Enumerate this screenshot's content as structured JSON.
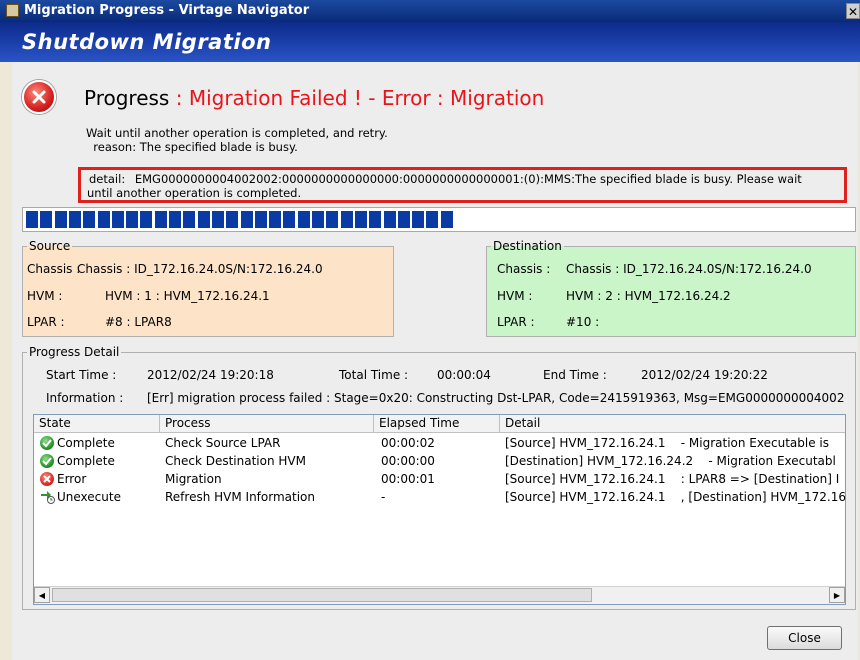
{
  "window": {
    "title": "Migration Progress - Virtage Navigator",
    "close_glyph": "✕"
  },
  "banner": {
    "title": "Shutdown Migration"
  },
  "status": {
    "label": "Progress",
    "separator": ":",
    "message": "Migration Failed ! - Error : Migration",
    "wait_line": "Wait until another operation is completed, and retry.",
    "reason_line": "  reason: The specified blade is busy.",
    "detail_label": "detail:",
    "detail_line1": "EMG0000000004002002:0000000000000000:0000000000000001:(0):MMS:The specified blade is busy. Please wait",
    "detail_line2": "until another operation is completed.",
    "progress_fraction": 0.52,
    "progress_segments": 30
  },
  "source": {
    "legend": "Source",
    "chassis_label": "Chassis :",
    "chassis_value": "Chassis : ID_172.16.24.0S/N:172.16.24.0",
    "hvm_label": "HVM :",
    "hvm_value": "HVM : 1 : HVM_172.16.24.1",
    "lpar_label": "LPAR :",
    "lpar_value": "#8 : LPAR8"
  },
  "destination": {
    "legend": "Destination",
    "chassis_label": "Chassis :",
    "chassis_value": "Chassis : ID_172.16.24.0S/N:172.16.24.0",
    "hvm_label": "HVM :",
    "hvm_value": "HVM : 2 : HVM_172.16.24.2",
    "lpar_label": "LPAR :",
    "lpar_value": "#10 :"
  },
  "progress_detail": {
    "legend": "Progress Detail",
    "start_label": "Start Time :",
    "start_value": "2012/02/24 19:20:18",
    "total_label": "Total Time :",
    "total_value": "00:00:04",
    "end_label": "End Time :",
    "end_value": "2012/02/24 19:20:22",
    "info_label": "Information :",
    "info_value": "[Err] migration process failed : Stage=0x20: Constructing Dst-LPAR, Code=2415919363, Msg=EMG0000000004002",
    "columns": [
      "State",
      "Process",
      "Elapsed Time",
      "Detail"
    ],
    "rows": [
      {
        "icon": "check-icon",
        "state": "Complete",
        "process": "Check Source LPAR",
        "elapsed": "00:00:02",
        "detail": "[Source] HVM_172.16.24.1    - Migration Executable is"
      },
      {
        "icon": "check-icon",
        "state": "Complete",
        "process": "Check Destination HVM",
        "elapsed": "00:00:00",
        "detail": "[Destination] HVM_172.16.24.2    - Migration Executabl"
      },
      {
        "icon": "error-icon",
        "state": "Error",
        "process": "Migration",
        "elapsed": "00:00:01",
        "detail": "[Source] HVM_172.16.24.1    : LPAR8 => [Destination] I"
      },
      {
        "icon": "unexecute-icon",
        "state": "Unexecute",
        "process": "Refresh HVM Information",
        "elapsed": "-",
        "detail": "[Source] HVM_172.16.24.1    , [Destination] HVM_172.16"
      }
    ]
  },
  "buttons": {
    "close": "Close"
  },
  "colors": {
    "error_red": "#e8141a",
    "banner_blue": "#1d43b0",
    "progress_blue": "#0a3aa4",
    "source_bg": "#fde3c8",
    "destination_bg": "#c9f5c9"
  }
}
